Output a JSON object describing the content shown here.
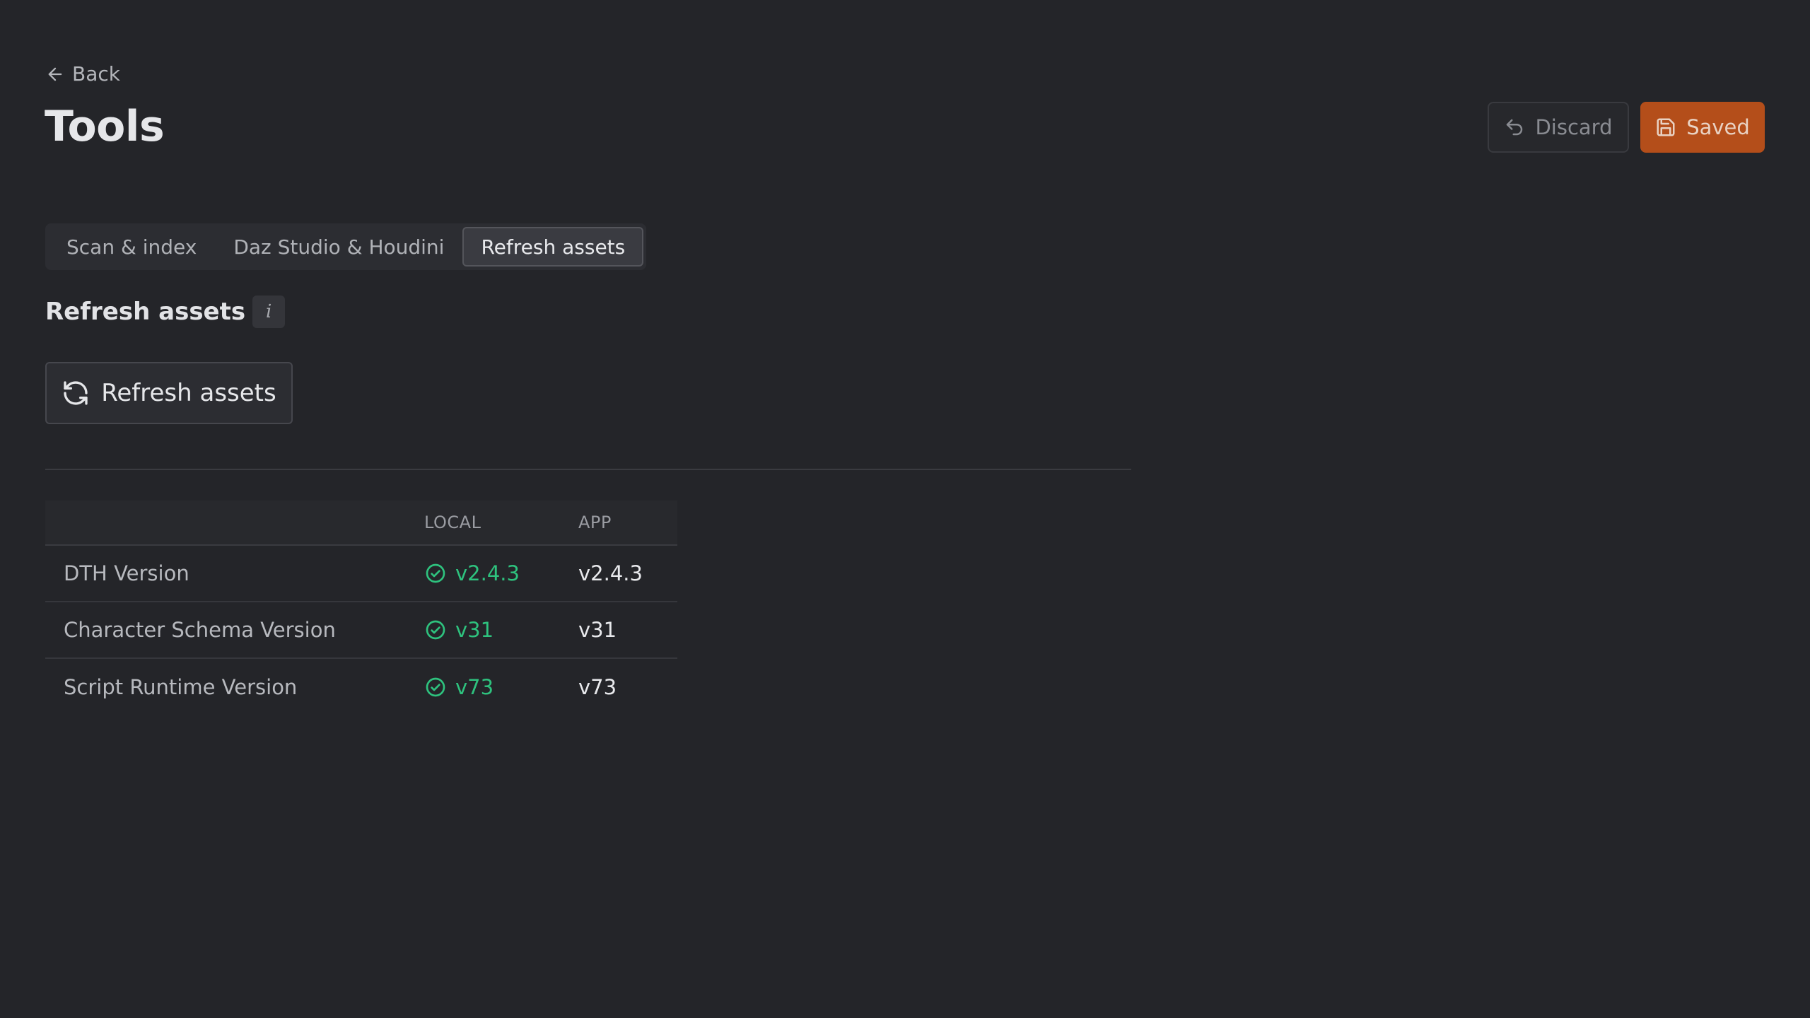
{
  "header": {
    "back_label": "Back",
    "title": "Tools",
    "discard_label": "Discard",
    "saved_label": "Saved"
  },
  "tabs": [
    {
      "label": "Scan & index",
      "active": false
    },
    {
      "label": "Daz Studio & Houdini",
      "active": false
    },
    {
      "label": "Refresh assets",
      "active": true
    }
  ],
  "section": {
    "title": "Refresh assets",
    "info_glyph": "i",
    "button_label": "Refresh assets"
  },
  "versions": {
    "columns": [
      "",
      "LOCAL",
      "APP"
    ],
    "rows": [
      {
        "name": "DTH Version",
        "local": "v2.4.3",
        "app": "v2.4.3",
        "status": "check-circle-icon"
      },
      {
        "name": "Character Schema Version",
        "local": "v31",
        "app": "v31",
        "status": "check-circle-icon"
      },
      {
        "name": "Script Runtime Version",
        "local": "v73",
        "app": "v73",
        "status": "check-circle-icon"
      }
    ]
  },
  "colors": {
    "background": "#242529",
    "accent": "#b44e1a",
    "ok": "#2ec27e"
  }
}
